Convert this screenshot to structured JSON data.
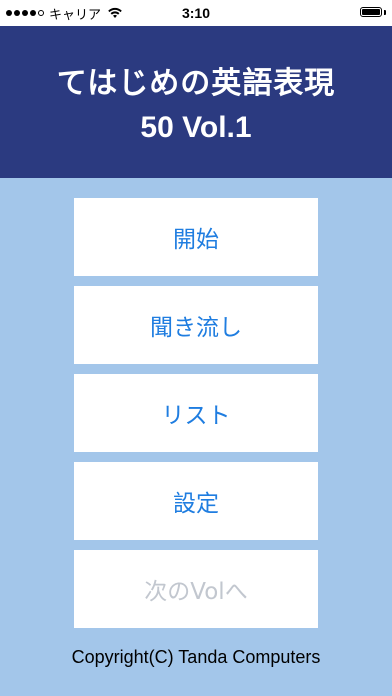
{
  "status_bar": {
    "carrier": "キャリア",
    "time": "3:10"
  },
  "header": {
    "title_line1": "てはじめの英語表現",
    "title_line2": "50 Vol.1"
  },
  "menu": {
    "start": "開始",
    "listen": "聞き流し",
    "list": "リスト",
    "settings": "設定",
    "next_vol": "次のVolへ"
  },
  "footer": {
    "copyright": "Copyright(C) Tanda Computers"
  },
  "colors": {
    "background": "#a3c6ea",
    "header": "#2b3a80",
    "accent": "#1f7de0",
    "disabled": "#c2c7cf"
  }
}
